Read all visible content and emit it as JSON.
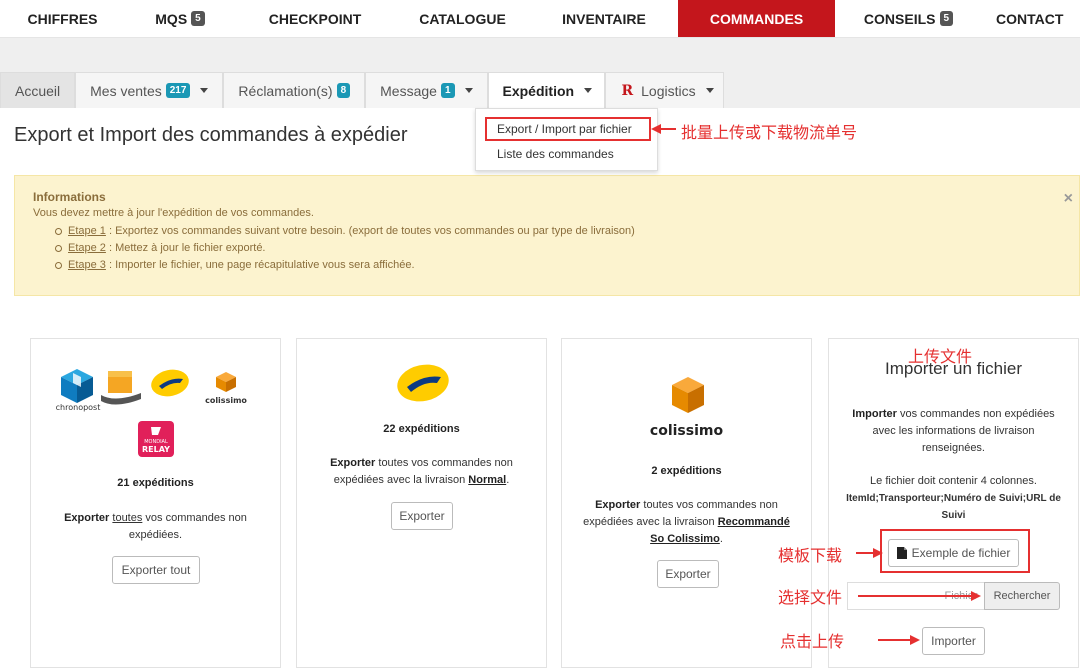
{
  "top_nav": [
    {
      "label": "CHIFFRES",
      "badge": "",
      "active": false
    },
    {
      "label": "MQS",
      "badge": "5",
      "active": false
    },
    {
      "label": "CHECKPOINT",
      "badge": "",
      "active": false
    },
    {
      "label": "CATALOGUE",
      "badge": "",
      "active": false
    },
    {
      "label": "INVENTAIRE",
      "badge": "",
      "active": false
    },
    {
      "label": "COMMANDES",
      "badge": "",
      "active": true
    },
    {
      "label": "CONSEILS",
      "badge": "5",
      "active": false
    },
    {
      "label": "CONTACT",
      "badge": "",
      "active": false
    }
  ],
  "tabs": {
    "accueil": "Accueil",
    "ventes": "Mes ventes",
    "ventes_badge": "217",
    "reclamations": "Réclamation(s)",
    "reclamations_badge": "8",
    "message": "Message",
    "message_badge": "1",
    "expedition": "Expédition",
    "logistics_logo": "R",
    "logistics": "Logistics"
  },
  "dropdown": {
    "item1": "Export / Import par fichier",
    "item2": "Liste des commandes"
  },
  "page_title": "Export et Import des commandes à expédier",
  "annotations": {
    "bulk": "批量上传或下载物流单号",
    "upload_file": "上传文件",
    "template": "模板下载",
    "choose": "选择文件",
    "click_upload": "点击上传"
  },
  "info": {
    "title": "Informations",
    "intro": "Vous devez mettre à jour l'expédition de vos commandes.",
    "steps": [
      {
        "link": "Etape 1",
        "text": " : Exportez vos commandes suivant votre besoin. (export de toutes vos commandes ou par type de livraison)"
      },
      {
        "link": "Etape 2",
        "text": " : Mettez à jour le fichier exporté."
      },
      {
        "link": "Etape 3",
        "text": " : Importer le fichier, une page récapitulative vous sera affichée."
      }
    ],
    "close": "×"
  },
  "cards": {
    "all": {
      "chronopost": "chronopost",
      "colissimo": "colissimo",
      "relay": "RELAY",
      "relay_top": "MONDIAL",
      "count": "21 expéditions",
      "desc_b": "Exporter",
      "desc_link": "toutes",
      "desc_rest": " vos commandes non expédiées.",
      "button": "Exporter tout"
    },
    "normal": {
      "count": "22 expéditions",
      "desc_b": "Exporter",
      "desc_mid": " toutes vos commandes non expédiées avec la livraison ",
      "desc_u": "Normal",
      "desc_end": ".",
      "button": "Exporter"
    },
    "colissimo": {
      "logo": "colissimo",
      "count": "2 expéditions",
      "desc_b": "Exporter",
      "desc_mid": " toutes vos commandes non expédiées avec la livraison ",
      "desc_u": "Recommandé So Colissimo",
      "desc_end": ".",
      "button": "Exporter"
    },
    "import": {
      "title": "Importer un fichier",
      "p1_b": "Importer",
      "p1_rest": " vos commandes non expédiées avec les informations de livraison renseignées.",
      "p2": "Le fichier doit contenir 4 colonnes.",
      "p3": "ItemId;Transporteur;Numéro de Suivi;URL de Suivi",
      "example_button": "Exemple de fichier",
      "file_placeholder": "Fichier",
      "browse_button": "Rechercher",
      "import_button": "Importer"
    }
  },
  "colors": {
    "accent": "#c4161c",
    "annotation": "#e53030",
    "info_bg": "#fcf3cf",
    "info_text": "#8a6d3b",
    "laposte_yellow": "#ffcc00",
    "colissimo_orange": "#f08c00",
    "chronopost_blue": "#0082c3"
  }
}
